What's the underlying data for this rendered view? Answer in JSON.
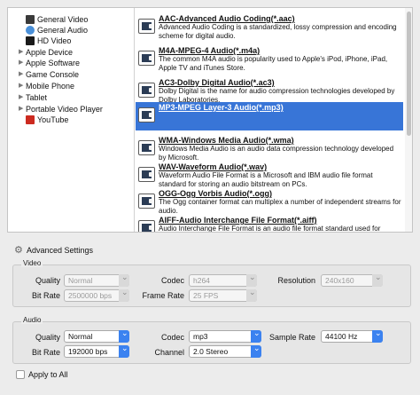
{
  "tree": {
    "items": [
      {
        "label": "General Video",
        "expandable": false,
        "icon": "general-video-icon",
        "color": "#3a3a3a"
      },
      {
        "label": "General Audio",
        "expandable": false,
        "icon": "general-audio-icon",
        "color": "#4a90d9"
      },
      {
        "label": "HD Video",
        "expandable": false,
        "icon": "hd-video-icon",
        "color": "#1a1a1a"
      },
      {
        "label": "Apple Device",
        "expandable": true
      },
      {
        "label": "Apple Software",
        "expandable": true
      },
      {
        "label": "Game Console",
        "expandable": true
      },
      {
        "label": "Mobile Phone",
        "expandable": true
      },
      {
        "label": "Tablet",
        "expandable": true
      },
      {
        "label": "Portable Video Player",
        "expandable": true
      },
      {
        "label": "YouTube",
        "expandable": false,
        "icon": "youtube-icon",
        "color": "#cc2a1f"
      }
    ]
  },
  "formats": [
    {
      "title": "AAC-Advanced Audio Coding(*.aac)",
      "desc": "Advanced Audio Coding is a standardized, lossy compression and encoding scheme for digital audio."
    },
    {
      "title": "M4A-MPEG-4 Audio(*.m4a)",
      "desc": "The common M4A audio is popularity used to Apple's iPod, iPhone, iPad, Apple TV and iTunes Store."
    },
    {
      "title": "AC3-Dolby Digital Audio(*.ac3)",
      "desc": "Dolby Digital is the name for audio compression technologies developed by Dolby Laboratories."
    },
    {
      "title": "MP3-MPEG Layer-3 Audio(*.mp3)",
      "desc": "",
      "selected": true
    },
    {
      "title": "WMA-Windows Media Audio(*.wma)",
      "desc": "Windows Media Audio is an audio data compression technology developed by Microsoft."
    },
    {
      "title": "WAV-Waveform Audio(*.wav)",
      "desc": "Waveform Audio File Format is a Microsoft and IBM audio file format standard for storing an audio bitstream on PCs."
    },
    {
      "title": "OGG-Ogg Vorbis Audio(*.ogg)",
      "desc": "The Ogg container format can multiplex a number of independent streams for audio."
    },
    {
      "title": "AIFF-Audio Interchange File Format(*.aiff)",
      "desc": "Audio Interchange File Format is an audio file format standard used for storing sound data for personal computers and other electronic audio devices."
    }
  ],
  "advanced": {
    "label": "Advanced Settings"
  },
  "video": {
    "title": "Video",
    "quality_label": "Quality",
    "quality": "Normal",
    "codec_label": "Codec",
    "codec": "h264",
    "resolution_label": "Resolution",
    "resolution": "240x160",
    "bitrate_label": "Bit Rate",
    "bitrate": "2500000 bps",
    "framerate_label": "Frame Rate",
    "framerate": "25 FPS"
  },
  "audio": {
    "title": "Audio",
    "quality_label": "Quality",
    "quality": "Normal",
    "codec_label": "Codec",
    "codec": "mp3",
    "samplerate_label": "Sample Rate",
    "samplerate": "44100 Hz",
    "bitrate_label": "Bit Rate",
    "bitrate": "192000 bps",
    "channel_label": "Channel",
    "channel": "2.0 Stereo"
  },
  "apply_all": {
    "label": "Apply to All",
    "checked": false
  },
  "colors": {
    "selection": "#3875d7",
    "accent": "#3b82f0"
  }
}
